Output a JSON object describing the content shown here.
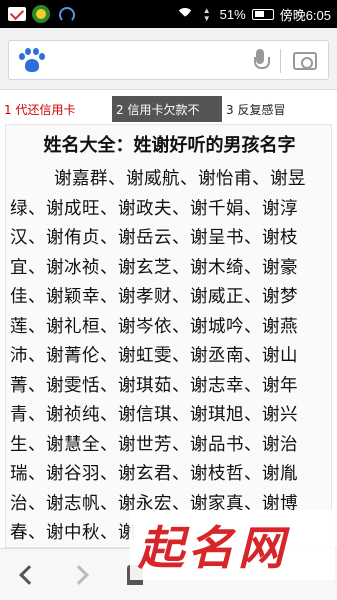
{
  "status_bar": {
    "battery": "51%",
    "time": "傍晚6:05",
    "net_label": "3G/4G"
  },
  "search": {
    "logo_icon": "baidu-paw-icon",
    "placeholder": ""
  },
  "suggestions": [
    {
      "label": "1  代还信用卡"
    },
    {
      "label": "2  信用卡欠款不"
    },
    {
      "label": "3  反复感冒"
    }
  ],
  "article": {
    "title": "姓名大全：姓谢好听的男孩名字",
    "lines": [
      "谢嘉群、谢威航、谢怡甫、谢昱",
      "绿、谢成旺、谢政夫、谢千娟、谢淳",
      "汉、谢侑贞、谢岳云、谢呈书、谢枝",
      "宜、谢冰祯、谢玄芝、谢木绮、谢豪",
      "佳、谢颖幸、谢孝财、谢威正、谢梦",
      "莲、谢礼桓、谢岑依、谢城吟、谢燕",
      "沛、谢菁伦、谢虹雯、谢丞南、谢山",
      "菁、谢雯恬、谢琪茹、谢志幸、谢年",
      "青、谢祯纯、谢信琪、谢琪旭、谢兴",
      "生、谢慧全、谢世芳、谢品书、谢治",
      "瑞、谢谷羽、谢玄君、谢枝哲、谢胤",
      "治、谢志帆、谢永宏、谢家真、谢博",
      "春、谢中秋、谢"
    ]
  },
  "watermark": {
    "text": "起名网"
  },
  "bottom_nav": {
    "back_icon": "back-arrow-icon",
    "forward_icon": "forward-arrow-icon",
    "home_icon": "home-icon"
  }
}
